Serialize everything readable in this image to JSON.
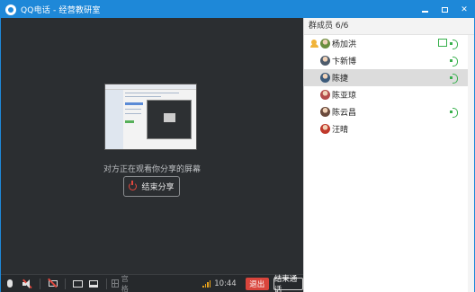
{
  "window": {
    "title": "QQ电话 - 经营教研室"
  },
  "main": {
    "watching_text": "对方正在观看你分享的屏幕",
    "end_share_label": "结束分享"
  },
  "toolbar": {
    "grid_label": "宫格",
    "time": "10:44",
    "quit_label": "退出",
    "end_call_label": "结束通话"
  },
  "members": {
    "header": "群成员 6/6",
    "list": [
      {
        "name": "杨加洪",
        "avatar_color": "#6b8e3f",
        "speaking": true,
        "sharing": true
      },
      {
        "name": "卞新博",
        "avatar_color": "#4d5b6b",
        "speaking": true,
        "sharing": false
      },
      {
        "name": "陈捷",
        "avatar_color": "#3c5a7a",
        "speaking": true,
        "sharing": false
      },
      {
        "name": "陈亚琼",
        "avatar_color": "#b44b4b",
        "speaking": false,
        "sharing": false
      },
      {
        "name": "陈云昌",
        "avatar_color": "#6a4a3c",
        "speaking": true,
        "sharing": false
      },
      {
        "name": "汪晴",
        "avatar_color": "#c0392b",
        "speaking": false,
        "sharing": false
      }
    ]
  },
  "colors": {
    "accent": "#1e88d8",
    "danger": "#d9453c",
    "speaking": "#37b04c"
  }
}
